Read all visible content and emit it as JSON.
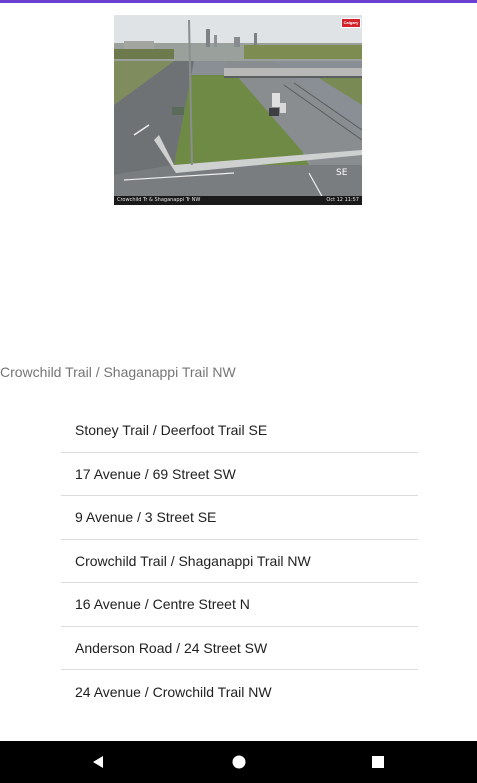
{
  "camera": {
    "caption_left": "Crowchild Tr & Shaganappi Tr NW",
    "caption_right": "Oct 12 11:57",
    "road_marking": "SE",
    "logo_text": "Calgary"
  },
  "current_camera_label": "Crowchild Trail / Shaganappi Trail NW",
  "camera_list": [
    "Stoney Trail / Deerfoot Trail SE",
    "17 Avenue / 69 Street SW",
    "9 Avenue / 3 Street SE",
    "Crowchild Trail / Shaganappi Trail NW",
    "16 Avenue / Centre Street N",
    "Anderson Road / 24 Street SW",
    "24 Avenue / Crowchild Trail NW"
  ],
  "colors": {
    "accent": "#6a3fd0",
    "list_text": "#212121",
    "secondary_text": "#757575",
    "divider": "#dcdcdc",
    "nav_bar": "#000000"
  },
  "nav": {
    "back_icon": "back-triangle-icon",
    "home_icon": "home-circle-icon",
    "recents_icon": "recents-square-icon"
  }
}
